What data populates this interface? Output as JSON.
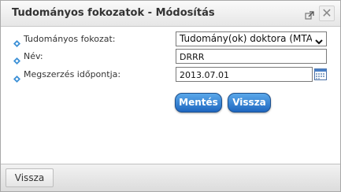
{
  "dialog": {
    "title": "Tudományos fokozatok - Módosítás",
    "close_glyph": "✕"
  },
  "form": {
    "degree_label": "Tudományos fokozat:",
    "degree_value": "Tudomány(ok) doktora (MTA",
    "name_label": "Név:",
    "name_value": "DRRR",
    "date_label": "Megszerzés időpontja:",
    "date_value": "2013.07.01"
  },
  "actions": {
    "save_label": "Mentés",
    "back_label": "Vissza"
  },
  "footer": {
    "back_label": "Vissza"
  },
  "icons": {
    "popout": "popout-icon",
    "close": "close-icon",
    "bullet": "diamond-bullet-icon",
    "dropdown": "chevron-down-icon",
    "calendar": "calendar-icon"
  },
  "colors": {
    "primary_button": "#2a74c9",
    "bullet": "#3a8fd6"
  }
}
